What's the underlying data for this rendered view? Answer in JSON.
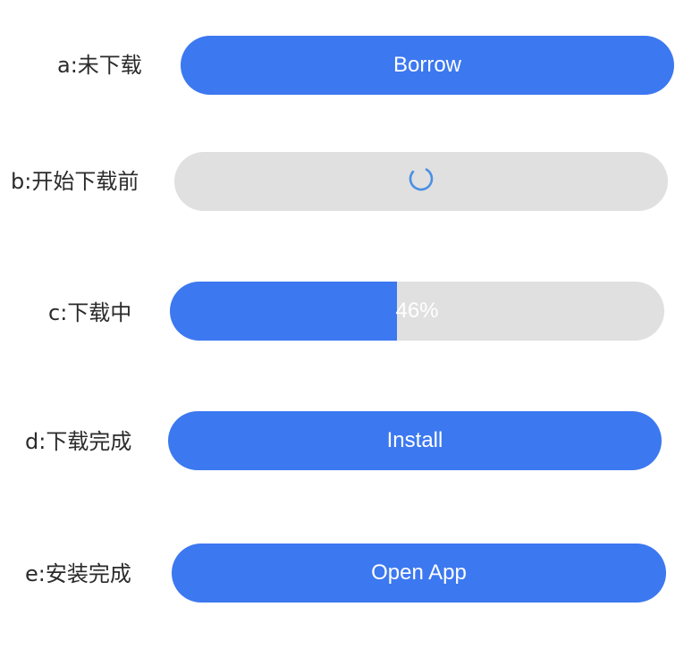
{
  "rows": [
    {
      "label": "a:未下载",
      "button_label": "Borrow"
    },
    {
      "label": "b:开始下载前",
      "icon": "loading-spinner-icon"
    },
    {
      "label": "c:下载中",
      "progress_percent": 46,
      "progress_text": "46%"
    },
    {
      "label": "d:下载完成",
      "button_label": "Install"
    },
    {
      "label": "e:安装完成",
      "button_label": "Open App"
    }
  ],
  "colors": {
    "primary": "#3c78f0",
    "track": "#e0e0e0",
    "spinner": "#4a90e2"
  }
}
